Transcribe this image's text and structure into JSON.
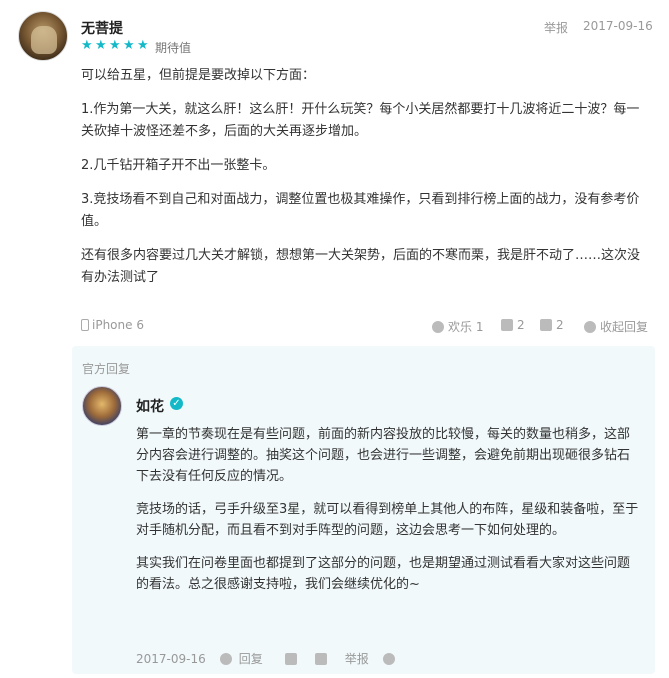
{
  "review": {
    "username": "无菩提",
    "report_label": "举报",
    "date": "2017-09-16",
    "stars": [
      "★",
      "★",
      "★",
      "★",
      "★"
    ],
    "rating_text": "期待值",
    "paragraphs": [
      "可以给五星，但前提是要改掉以下方面：",
      "1.作为第一大关，就这么肝！这么肝！开什么玩笑？每个小关居然都要打十几波将近二十波？每一关砍掉十波怪还差不多，后面的大关再逐步增加。",
      "2.几千钻开箱子开不出一张整卡。",
      "3.竞技场看不到自己和对面战力，调整位置也极其难操作，只看到排行榜上面的战力，没有参考价值。",
      "还有很多内容要过几大关才解锁，想想第一大关架势，后面的不寒而栗，我是肝不动了……这次没有办法测试了"
    ],
    "device": "iPhone 6",
    "happy_label": "欢乐 1",
    "like_count": "2",
    "dislike_count": "2",
    "fold_label": "收起回复"
  },
  "official": {
    "title": "官方回复",
    "name": "如花",
    "verify_glyph": "✓",
    "paragraphs": [
      "第一章的节奏现在是有些问题，前面的新内容投放的比较慢，每关的数量也稍多，这部分内容会进行调整的。抽奖这个问题，也会进行一些调整，会避免前期出现砸很多钻石下去没有任何反应的情况。",
      "竞技场的话，弓手升级至3星，就可以看得到榜单上其他人的布阵，星级和装备啦，至于对手随机分配，而且看不到对手阵型的问题，这边会思考一下如何处理的。",
      "其实我们在问卷里面也都提到了这部分的问题，也是期望通过测试看看大家对这些问题的看法。总之很感谢支持啦，我们会继续优化的~"
    ],
    "date": "2017-09-16",
    "reply_label": "回复",
    "report_label": "举报"
  }
}
